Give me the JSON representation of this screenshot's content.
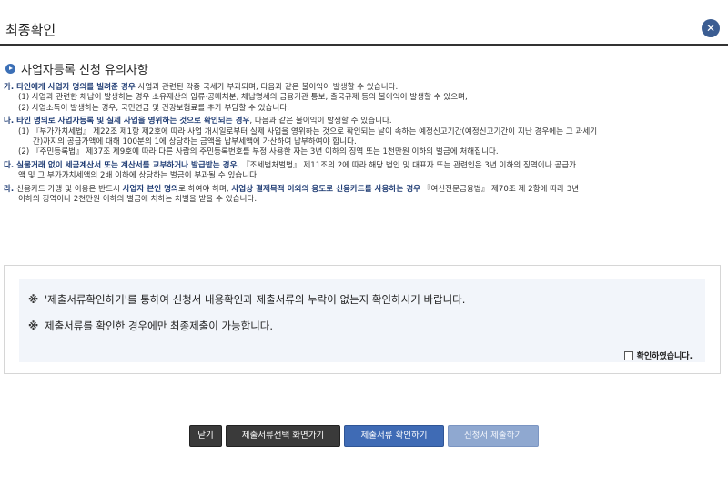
{
  "header": {
    "title": "최종확인",
    "close_label": "✕"
  },
  "section": {
    "title": "사업자등록 신청 유의사항"
  },
  "notices": [
    {
      "lines": [
        [
          {
            "t": "가. ",
            "c": "mk"
          },
          {
            "t": "타인에게 사업자 명의를 빌려준 경우",
            "c": "hl"
          },
          {
            "t": " 사업과 관련된 각종 국세가 부과되며, 다음과 같은 불이익이 발생할 수 있습니다."
          }
        ],
        [
          {
            "t": "(1) 사업과 관련한 체납이 발생하는 경우 소유재산의 압류·공매처분, 체납명세의 금융기관 통보, 출국규제 등의 불이익이 발생할 수 있으며,",
            "s": "sub"
          }
        ],
        [
          {
            "t": "(2) 사업소득이 발생하는 경우, 국민연금 및 건강보험료를 추가 부담할 수 있습니다.",
            "s": "sub"
          }
        ]
      ]
    },
    {
      "lines": [
        [
          {
            "t": "나. ",
            "c": "mk"
          },
          {
            "t": "타인 명의로 사업자등록 및 실제 사업을 영위하는 것으로 확인되는 경우",
            "c": "hl"
          },
          {
            "t": ", 다음과 같은 불이익이 발생할 수 있습니다."
          }
        ],
        [
          {
            "t": "(1) 『부가가치세법』 제22조 제1항 제2호에 따라 사업 개시일로부터 실제 사업을 영위하는 것으로 확인되는 날이 속하는 예정신고기간(예정신고기간이 지난 경우에는 그 과세기",
            "s": "sub"
          }
        ],
        [
          {
            "t": "간)까지의 공급가액에 대해 100분의 1에 상당하는 금액을 납부세액에 가산하여 납부하여야 합니다.",
            "s": "sub-cont"
          }
        ],
        [
          {
            "t": "(2) 『주민등록법』 제37조 제9호에 따라 다른 사람의 주민등록번호를 부정 사용한 자는 3년 이하의 징역 또는 1천만원 이하의 벌금에 처해집니다.",
            "s": "sub"
          }
        ]
      ]
    },
    {
      "lines": [
        [
          {
            "t": "다. ",
            "c": "mk"
          },
          {
            "t": "실물거래 없이 세금계산서 또는 계산서를 교부하거나 발급받는 경우",
            "c": "hl"
          },
          {
            "t": ", 『조세범처벌법』 제11조의 2에 따라 해당 법인 및 대표자 또는 관련인은 3년 이하의 징역이나 공급가"
          }
        ],
        [
          {
            "t": "액 및 그 부가가치세액의 2배 이하에 상당하는 벌금이 부과될 수 있습니다.",
            "s": "sub"
          }
        ]
      ]
    },
    {
      "lines": [
        [
          {
            "t": "라. ",
            "c": "mk"
          },
          {
            "t": "신용카드 가맹 및 이용은 반드시 "
          },
          {
            "t": "사업자 본인 명의",
            "c": "hl"
          },
          {
            "t": "로 하여야 하며, "
          },
          {
            "t": "사업상 결제목적 이외의 용도로 신용카드를 사용하는 경우",
            "c": "hl"
          },
          {
            "t": " 『여신전문금융법』 제70조 제 2항에 따라 3년"
          }
        ],
        [
          {
            "t": "이하의 징역이나 2천만원 이하의 벌금에 처하는 처벌을 받을 수 있습니다.",
            "s": "sub"
          }
        ]
      ]
    }
  ],
  "confirm": {
    "star": "※",
    "line1": "'제출서류확인하기'를 통하여 신청서 내용확인과 제출서류의 누락이 없는지 확인하시기 바랍니다.",
    "line2": "제출서류를 확인한 경우에만 최종제출이 가능합니다.",
    "checkbox_label": "확인하였습니다."
  },
  "buttons": {
    "close": "닫기",
    "back": "제출서류선택 화면가기",
    "review": "제출서류 확인하기",
    "submit": "신청서 제출하기"
  }
}
